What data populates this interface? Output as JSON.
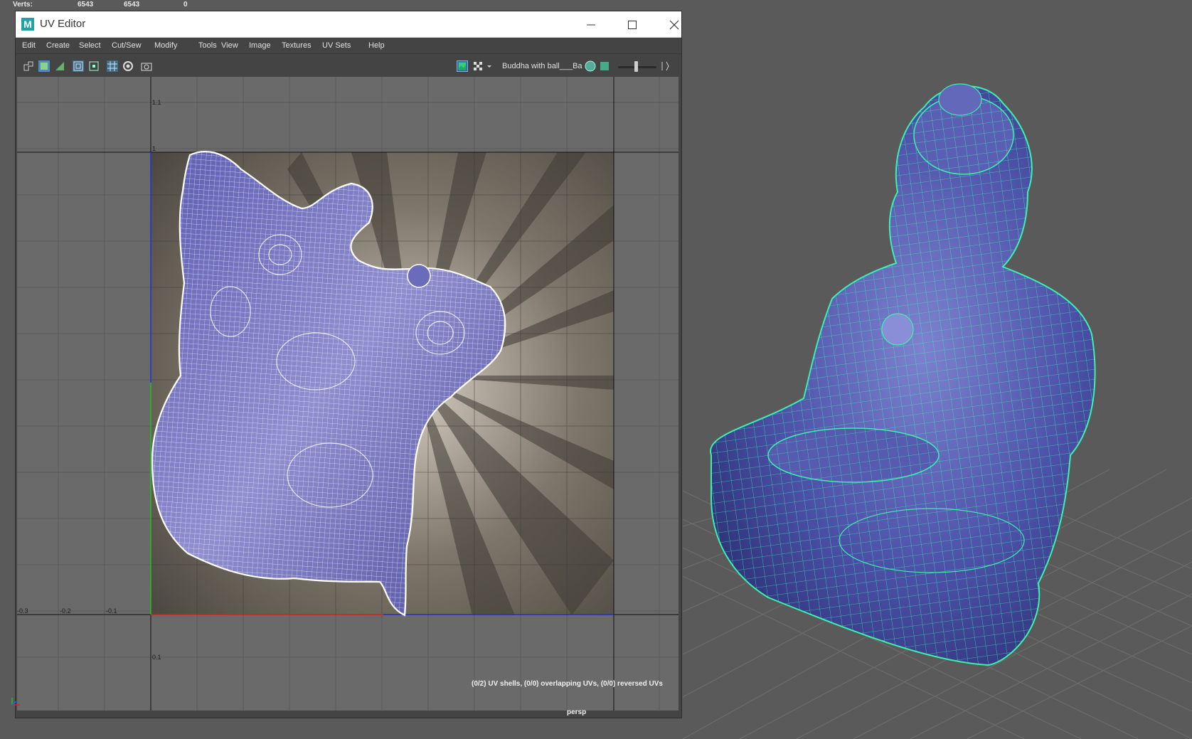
{
  "hud": {
    "label": "Verts:",
    "values": [
      "6543",
      "6543",
      "0"
    ]
  },
  "uv_editor": {
    "title": "UV Editor",
    "menu": [
      "Edit",
      "Create",
      "Select",
      "Cut/Sew",
      "Modify",
      "Tools",
      "View",
      "Image",
      "Textures",
      "UV Sets",
      "Help"
    ],
    "texture_name": "Buddha with ball___Ba",
    "ruler": {
      "v_labels": [
        "1.1",
        "1",
        "0.1"
      ],
      "u_labels": [
        "-0.3",
        "-0.2",
        "-0.1"
      ]
    },
    "status": "(0/2) UV shells, (0/0) overlapping UVs, (0/0) reversed UVs"
  },
  "viewport": {
    "camera_label": "persp"
  },
  "colors": {
    "uv_mesh_fill": "#5a5aa8",
    "uv_wire": "#ffffff",
    "model_fill": "#4b4fa6",
    "model_wire": "#3cf0b0",
    "u_axis": "#e02020",
    "v_axis": "#2030e0"
  },
  "icons": [
    "maya-logo-icon",
    "minimize-icon",
    "maximize-icon",
    "close-icon",
    "camera-icon",
    "checker-icon",
    "image-icon"
  ]
}
